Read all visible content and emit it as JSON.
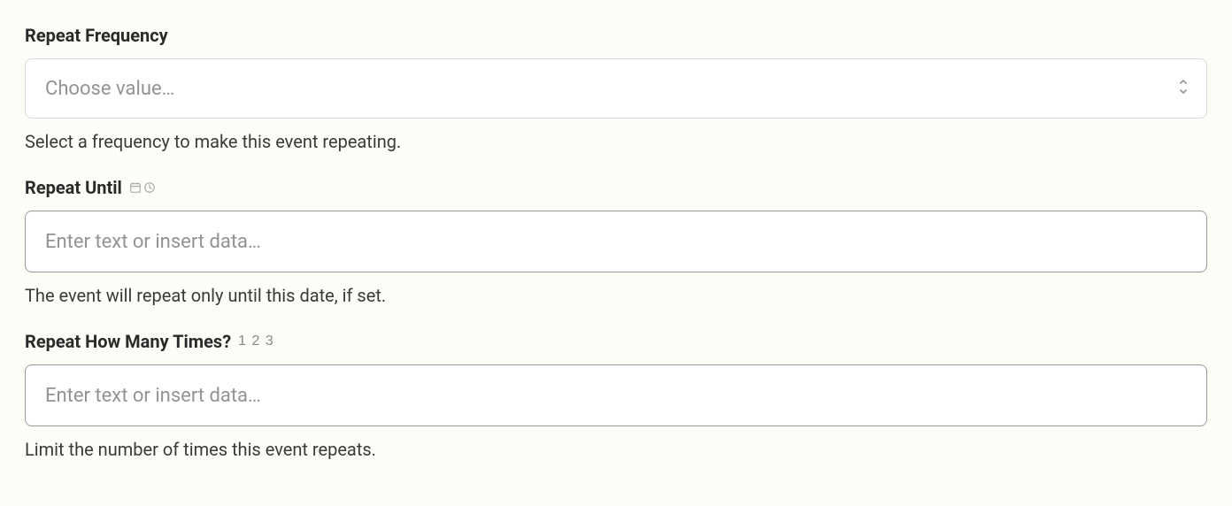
{
  "fields": {
    "repeatFrequency": {
      "label": "Repeat Frequency",
      "placeholder": "Choose value…",
      "help": "Select a frequency to make this event repeating."
    },
    "repeatUntil": {
      "label": "Repeat Until",
      "placeholder": "Enter text or insert data…",
      "help": "The event will repeat only until this date, if set."
    },
    "repeatCount": {
      "label": "Repeat How Many Times?",
      "hint": "1 2 3",
      "placeholder": "Enter text or insert data…",
      "help": "Limit the number of times this event repeats."
    }
  }
}
